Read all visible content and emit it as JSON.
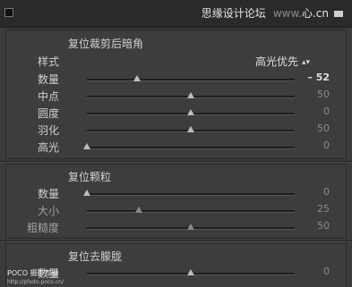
{
  "header": {
    "title": "思缘设计论坛",
    "title_b": "www.",
    "title_c": "心.cn",
    "collapse_icon": "square-collapse-icon"
  },
  "crop_vignette": {
    "title": "复位裁剪后暗角",
    "style_label": "样式",
    "style_value": "高光优先",
    "rows": [
      {
        "label": "数量",
        "value": "– 52",
        "fraction": 0.24,
        "active": true,
        "dim": false
      },
      {
        "label": "中点",
        "value": "50",
        "fraction": 0.5,
        "active": false,
        "dim": false
      },
      {
        "label": "圆度",
        "value": "0",
        "fraction": 0.5,
        "active": false,
        "dim": false
      },
      {
        "label": "羽化",
        "value": "50",
        "fraction": 0.5,
        "active": false,
        "dim": false
      },
      {
        "label": "高光",
        "value": "0",
        "fraction": 0.0,
        "active": false,
        "dim": false
      }
    ]
  },
  "grain": {
    "title": "复位颗粒",
    "rows": [
      {
        "label": "数量",
        "value": "0",
        "fraction": 0.0,
        "active": false,
        "dim": false
      },
      {
        "label": "大小",
        "value": "25",
        "fraction": 0.25,
        "active": false,
        "dim": true
      },
      {
        "label": "粗糙度",
        "value": "50",
        "fraction": 0.5,
        "active": false,
        "dim": true
      }
    ]
  },
  "dehaze": {
    "title": "复位去朦胧",
    "rows": [
      {
        "label": "数量",
        "value": "0",
        "fraction": 0.5,
        "active": false,
        "dim": false
      }
    ]
  },
  "watermark": {
    "line1": "POCO 摄影专题",
    "line2": "http://photo.poco.cn/"
  }
}
